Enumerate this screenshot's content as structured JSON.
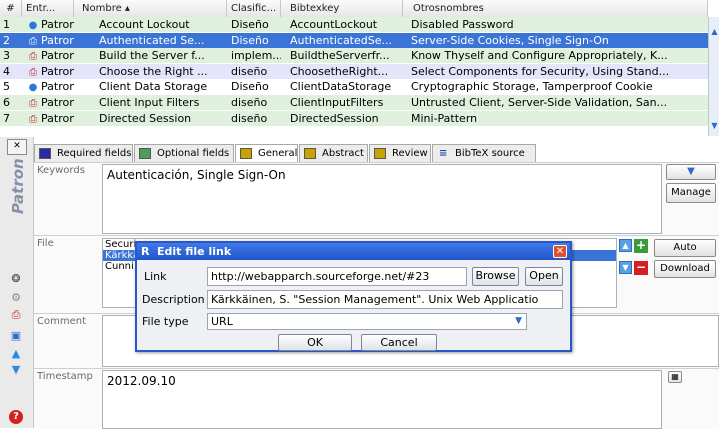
{
  "table": {
    "headers": [
      "#",
      "Entr...",
      "Nombre ▴",
      "Clasific...",
      "Bibtexkey",
      "Otrosnombres"
    ],
    "rows": [
      {
        "num": "1",
        "type": "Patron",
        "icon": "globe-icon",
        "name": "Account Lockout",
        "clasif": "Diseño",
        "key": "AccountLockout",
        "otros": "Disabled Password",
        "bg": "#dff0df"
      },
      {
        "num": "2",
        "type": "Patron",
        "icon": "pdf-icon",
        "name": "Authenticated Se...",
        "clasif": "Diseño",
        "key": "AuthenticatedSe...",
        "otros": "Server-Side Cookies, Single Sign-On",
        "bg": "#3a74d6",
        "selected": true
      },
      {
        "num": "3",
        "type": "Patron",
        "icon": "pdf-icon",
        "name": "Build the Server f...",
        "clasif": "implem...",
        "key": "BuildtheServerfr...",
        "otros": "Know Thyself and Configure Appropriately, K...",
        "bg": "#dff0df"
      },
      {
        "num": "4",
        "type": "Patron",
        "icon": "pdf-icon",
        "name": "Choose the Right ...",
        "clasif": "diseño",
        "key": "ChoosetheRight...",
        "otros": "Select Components for Security, Using Stand...",
        "bg": "#e4e4fb"
      },
      {
        "num": "5",
        "type": "Patron",
        "icon": "globe-icon",
        "name": "Client Data Storage",
        "clasif": "Diseño",
        "key": "ClientDataStorage",
        "otros": "Cryptographic Storage, Tamperproof Cookie",
        "bg": "#ffffff"
      },
      {
        "num": "6",
        "type": "Patron",
        "icon": "pdf-icon",
        "name": "Client Input Filters",
        "clasif": "diseño",
        "key": "ClientInputFilters",
        "otros": "Untrusted Client, Server-Side Validation, San...",
        "bg": "#dff0df"
      },
      {
        "num": "7",
        "type": "Patron",
        "icon": "pdf-icon",
        "name": "Directed Session",
        "clasif": "diseño",
        "key": "DirectedSession",
        "otros": "Mini-Pattern",
        "bg": "#dff0df"
      }
    ]
  },
  "sidebar": {
    "entry_type": "Patron"
  },
  "tabs": [
    {
      "label": "Required fields",
      "color": "#2a2aa8"
    },
    {
      "label": "Optional fields",
      "color": "#4aa05a"
    },
    {
      "label": "General",
      "color": "#c8a400",
      "active": true
    },
    {
      "label": "Abstract",
      "color": "#c8a400"
    },
    {
      "label": "Review",
      "color": "#c8a400"
    },
    {
      "label": "BibTeX source",
      "color": ""
    }
  ],
  "fields": {
    "keywords": {
      "label": "Keywords",
      "value": "Autenticación, Single Sign-On",
      "manage": "Manage"
    },
    "file": {
      "label": "File",
      "list": [
        "Securi",
        "Kärkkä",
        "Cunni"
      ],
      "auto": "Auto",
      "download": "Download"
    },
    "comment": {
      "label": "Comment"
    },
    "timestamp": {
      "label": "Timestamp",
      "value": "2012.09.10"
    }
  },
  "dialog": {
    "title": "Edit file link",
    "link_label": "Link",
    "link_value": "http://webapparch.sourceforge.net/#23",
    "browse": "Browse",
    "open": "Open",
    "desc_label": "Description",
    "desc_value": "Kärkkäinen, S. \"Session Management\". Unix Web Applicatio",
    "filetype_label": "File type",
    "filetype_value": "URL",
    "ok": "OK",
    "cancel": "Cancel"
  },
  "colors": {
    "selected": "#3a74d6",
    "dialog_title": "#1f55c9",
    "close": "#e0502a"
  }
}
